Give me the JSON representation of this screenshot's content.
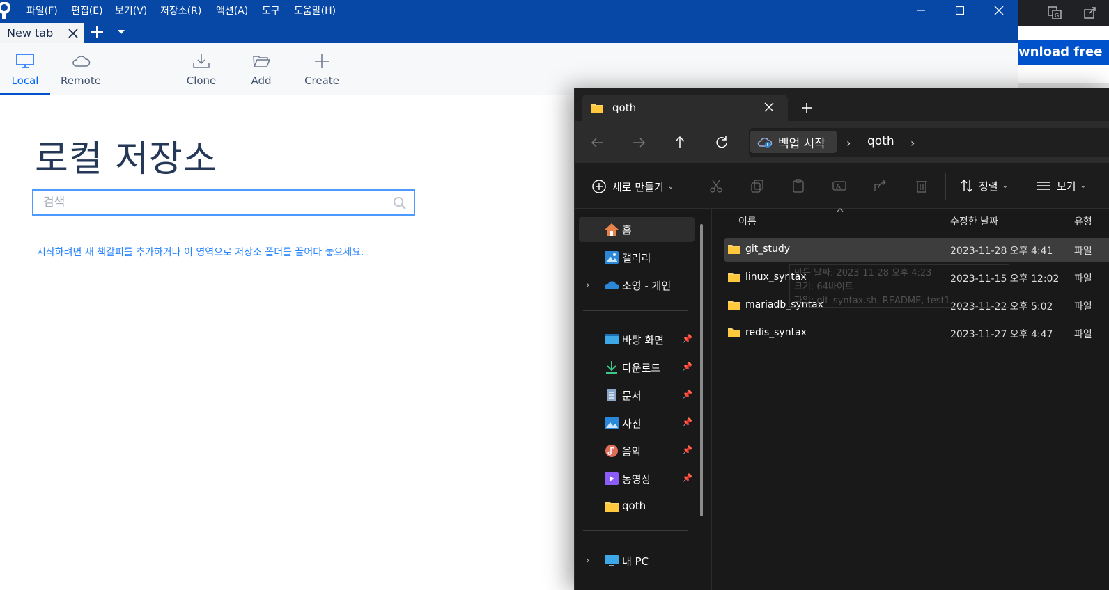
{
  "sourcetree": {
    "menu": [
      "파일(F)",
      "편집(E)",
      "보기(V)",
      "저장소(R)",
      "액션(A)",
      "도구",
      "도움말(H)"
    ],
    "tab": {
      "label": "New tab"
    },
    "toolbar": {
      "local": "Local",
      "remote": "Remote",
      "clone": "Clone",
      "add": "Add",
      "create": "Create"
    },
    "title": "로컬 저장소",
    "search": {
      "placeholder": "검색",
      "value": ""
    },
    "hint": "시작하려면 새 책갈피를 추가하거나 이 영역으로 저장소 폴더를 끌어다 놓으세요.",
    "colors": {
      "brand": "#0747a6",
      "accent": "#0052cc",
      "link": "#2684ff"
    }
  },
  "browser_strip": {
    "button_text": "wnload free"
  },
  "explorer": {
    "tab": {
      "label": "qoth"
    },
    "address": {
      "home": "백업 시작",
      "folder": "qoth"
    },
    "commands": {
      "new": "새로 만들기",
      "sort": "정렬",
      "view": "보기"
    },
    "sidebar": {
      "home": "홈",
      "gallery": "갤러리",
      "onedrive": "소영 - 개인",
      "desktop": "바탕 화면",
      "downloads": "다운로드",
      "documents": "문서",
      "pictures": "사진",
      "music": "음악",
      "videos": "동영상",
      "qoth": "qoth",
      "thispc": "내 PC"
    },
    "columns": {
      "name": "이름",
      "modified": "수정한 날짜",
      "type": "유형"
    },
    "files": [
      {
        "name": "git_study",
        "modified": "2023-11-28 오후 4:41",
        "type": "파일"
      },
      {
        "name": "linux_syntax",
        "modified": "2023-11-15 오후 12:02",
        "type": "파일"
      },
      {
        "name": "mariadb_syntax",
        "modified": "2023-11-22 오후 5:02",
        "type": "파일"
      },
      {
        "name": "redis_syntax",
        "modified": "2023-11-27 오후 4:47",
        "type": "파일"
      }
    ],
    "tooltip": {
      "line1": "만든 날짜: 2023-11-28 오후 4:23",
      "line2": "크기: 64바이트",
      "line3": "파일: git_syntax.sh, README, test1"
    }
  }
}
